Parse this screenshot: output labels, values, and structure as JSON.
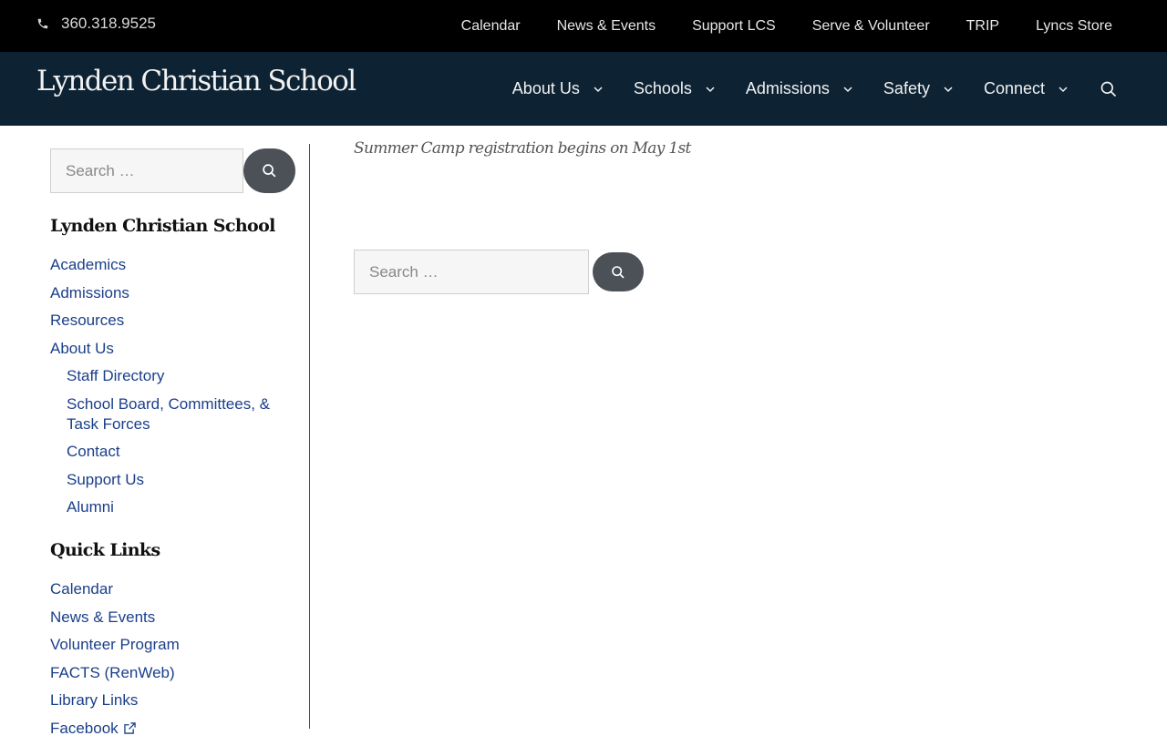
{
  "topbar": {
    "phone": "360.318.9525",
    "links": [
      "Calendar",
      "News & Events",
      "Support LCS",
      "Serve & Volunteer",
      "TRIP",
      "Lyncs Store"
    ]
  },
  "header": {
    "logo": "Lynden Christian School",
    "nav": [
      "About Us",
      "Schools",
      "Admissions",
      "Safety",
      "Connect"
    ]
  },
  "sidebar": {
    "search_placeholder": "Search …",
    "section1_title": "Lynden Christian School",
    "section1_links": [
      "Academics",
      "Admissions",
      "Resources",
      "About Us"
    ],
    "section1_sublinks": [
      "Staff Directory",
      "School Board, Committees, & Task Forces",
      "Contact",
      "Support Us",
      "Alumni"
    ],
    "section2_title": "Quick Links",
    "section2_links": [
      "Calendar",
      "News & Events",
      "Volunteer Program",
      "FACTS (RenWeb)",
      "Library Links",
      "Facebook"
    ]
  },
  "content": {
    "notice": "Summer Camp registration begins on May 1st",
    "search_placeholder": "Search …"
  },
  "colors": {
    "topbar_bg": "#000000",
    "header_bg": "#0d2233",
    "link": "#1a3f8a",
    "button": "#4c5057"
  },
  "icons": {
    "phone": "phone-icon",
    "search": "search-icon",
    "chevron": "chevron-down-icon",
    "external": "external-link-icon"
  }
}
